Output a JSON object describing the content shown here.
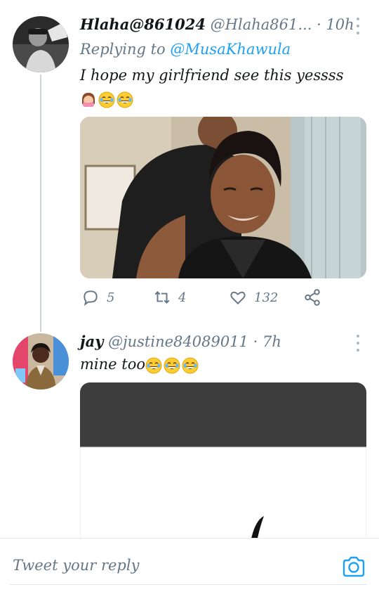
{
  "tweets": [
    {
      "display_name": "Hlaha@861024",
      "handle": "@Hlaha861...",
      "separator": "·",
      "time": "10h",
      "replying_label": "Replying to",
      "replying_to": "@MusaKhawula",
      "text": "I hope my girlfriend see this yessss",
      "emojis": [
        "face-palm-girl-emoji",
        "laughing-emoji",
        "laughing-emoji"
      ],
      "stats": {
        "replies": "5",
        "retweets": "4",
        "likes": "132"
      }
    },
    {
      "display_name": "jay",
      "handle": "@justine84089011",
      "separator": "·",
      "time": "7h",
      "text": "mine too",
      "emojis": [
        "laughing-emoji",
        "laughing-emoji",
        "laughing-emoji"
      ]
    }
  ],
  "composer": {
    "placeholder": "Tweet your reply"
  },
  "colors": {
    "accent": "#1da1f2",
    "muted": "#657786",
    "thread_line": "#ccd6dd"
  }
}
